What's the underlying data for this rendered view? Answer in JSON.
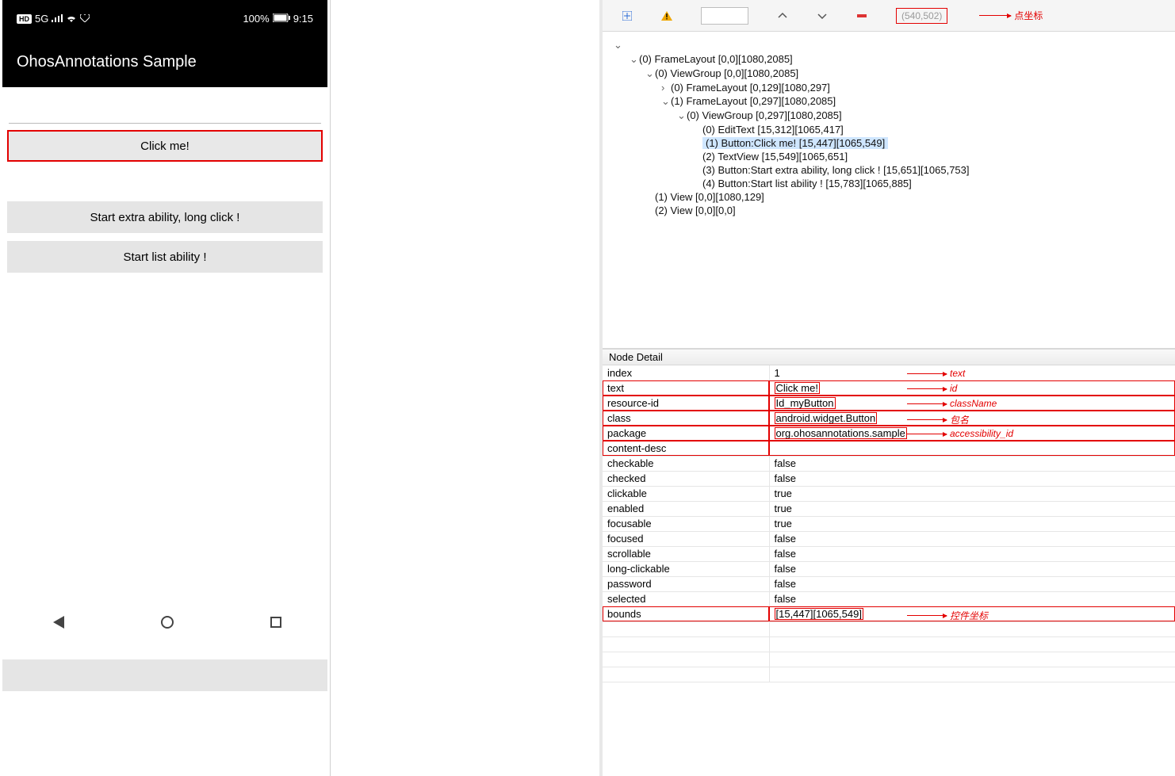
{
  "phone": {
    "status": {
      "hd": "HD",
      "net": "5G",
      "signal": "▮▮▮▮",
      "wifi": "⋮",
      "heart": "♡",
      "battery_pct": "100%",
      "battery_icon": "▢",
      "time": "9:15"
    },
    "title": "OhosAnnotations Sample",
    "buttons": {
      "click_me": "Click me!",
      "extra": "Start extra ability, long click !",
      "list": "Start list ability !"
    }
  },
  "toolbar": {
    "coord": "(540,502)",
    "label_coord": "点坐标"
  },
  "tree": {
    "l0": "(0) FrameLayout [0,0][1080,2085]",
    "l1": "(0) ViewGroup [0,0][1080,2085]",
    "l2a": "(0) FrameLayout [0,129][1080,297]",
    "l2b": "(1) FrameLayout [0,297][1080,2085]",
    "l3": "(0) ViewGroup [0,297][1080,2085]",
    "l4a": "(0) EditText [15,312][1065,417]",
    "l4b": "(1) Button:Click me! [15,447][1065,549]",
    "l4c": "(2) TextView [15,549][1065,651]",
    "l4d": "(3) Button:Start extra ability, long click ! [15,651][1065,753]",
    "l4e": "(4) Button:Start list ability ! [15,783][1065,885]",
    "l1b": "(1) View [0,0][1080,129]",
    "l1c": "(2) View [0,0][0,0]"
  },
  "detail": {
    "header": "Node Detail",
    "rows": [
      {
        "k": "index",
        "v": "1"
      },
      {
        "k": "text",
        "v": "Click me!"
      },
      {
        "k": "resource-id",
        "v": "Id_myButton"
      },
      {
        "k": "class",
        "v": "android.widget.Button"
      },
      {
        "k": "package",
        "v": "org.ohosannotations.sample"
      },
      {
        "k": "content-desc",
        "v": ""
      },
      {
        "k": "checkable",
        "v": "false"
      },
      {
        "k": "checked",
        "v": "false"
      },
      {
        "k": "clickable",
        "v": "true"
      },
      {
        "k": "enabled",
        "v": "true"
      },
      {
        "k": "focusable",
        "v": "true"
      },
      {
        "k": "focused",
        "v": "false"
      },
      {
        "k": "scrollable",
        "v": "false"
      },
      {
        "k": "long-clickable",
        "v": "false"
      },
      {
        "k": "password",
        "v": "false"
      },
      {
        "k": "selected",
        "v": "false"
      },
      {
        "k": "bounds",
        "v": "[15,447][1065,549]"
      }
    ],
    "annotations": {
      "text": "text",
      "id": "id",
      "class": "className",
      "package": "包名",
      "content": "accessibility_id",
      "bounds": "控件坐标"
    }
  }
}
